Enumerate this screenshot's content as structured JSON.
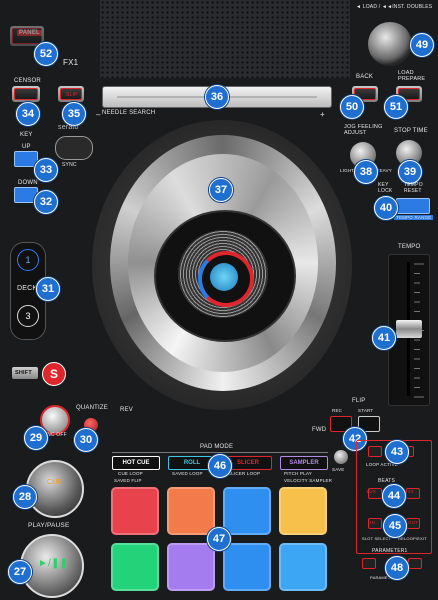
{
  "top": {
    "fx1_label": "FX1",
    "load_label": "◄ LOAD / ◄◄INST. DOUBLES",
    "needle_search_label": "NEEDLE SEARCH",
    "needle_plus": "+",
    "needle_minus": "–"
  },
  "left": {
    "panel_label": "PANEL",
    "censor_label": "CENSOR",
    "slip_label": "SLIP",
    "key_label": "KEY",
    "up_label": "UP",
    "down_label": "DOWN",
    "serato_label": "serato",
    "serato_sub": "SYNC",
    "shift_label": "SHIFT",
    "deck_label": "DECK",
    "deck_1": "1",
    "deck_3": "3",
    "s_label": "S",
    "sync_label": "SYNC OFF",
    "quantize_label": "QUANTIZE",
    "cue_label": "CUE",
    "play_pause_label": "PLAY/PAUSE",
    "play_symbol": "►/❚❚"
  },
  "right": {
    "back_label": "BACK",
    "load_prepare_label": "LOAD PREPARE",
    "jog_feeling_label": "JOG FEELING ADJUST",
    "light_label": "LIGHT",
    "heavy_label": "HEAVY",
    "stop_time_label": "STOP TIME",
    "key_lock_label": "KEY LOCK",
    "tempo_reset_label": "TEMPO RESET",
    "tempo_range_label": "TEMPO RANGE",
    "tempo_label": "TEMPO",
    "flip_label": "FLIP",
    "rec_label": "REC",
    "start_label": "START",
    "save_label": "SAVE",
    "loop_label": "LOOP ACTIVE",
    "beats_label": "BEATS",
    "loop_half": "1/2X",
    "loop_double": "2X",
    "in_label": "IN",
    "out_label": "OUT",
    "slot_select": "SLOT SELECT",
    "loop_exit": "RELOOP/EXIT",
    "parameter_label": "PARAMETER1",
    "parameter2_label": "PARAMETER2"
  },
  "jog": {
    "rev_label": "REV",
    "fwd_label": "FWD",
    "vinyl_label": "VINYL"
  },
  "pad_mode": {
    "title": "PAD MODE",
    "modes": [
      {
        "label": "HOT CUE",
        "sub": "CUE LOOP",
        "color": "#ffffff"
      },
      {
        "label": "ROLL",
        "sub": "SAVED LOOP",
        "color": "#3fc7e8"
      },
      {
        "label": "SLICER",
        "sub": "SLICER LOOP",
        "color": "#e0262d"
      },
      {
        "label": "SAMPLER",
        "sub": "PITCH PLAY",
        "color": "#b18be6"
      }
    ],
    "subsub": "SAVED FLIP",
    "velocity": "VELOCITY SAMPLER",
    "pad_colors": [
      "#e8424d",
      "#f37a4a",
      "#2f8ff0",
      "#f6c04a",
      "#23d37a",
      "#a47cf0",
      "#2f8ff0",
      "#3ca6f5"
    ]
  },
  "callouts": [
    "27",
    "28",
    "29",
    "30",
    "31",
    "32",
    "33",
    "34",
    "35",
    "36",
    "37",
    "38",
    "39",
    "40",
    "41",
    "42",
    "43",
    "44",
    "45",
    "46",
    "47",
    "48",
    "49",
    "50",
    "51",
    "52"
  ]
}
